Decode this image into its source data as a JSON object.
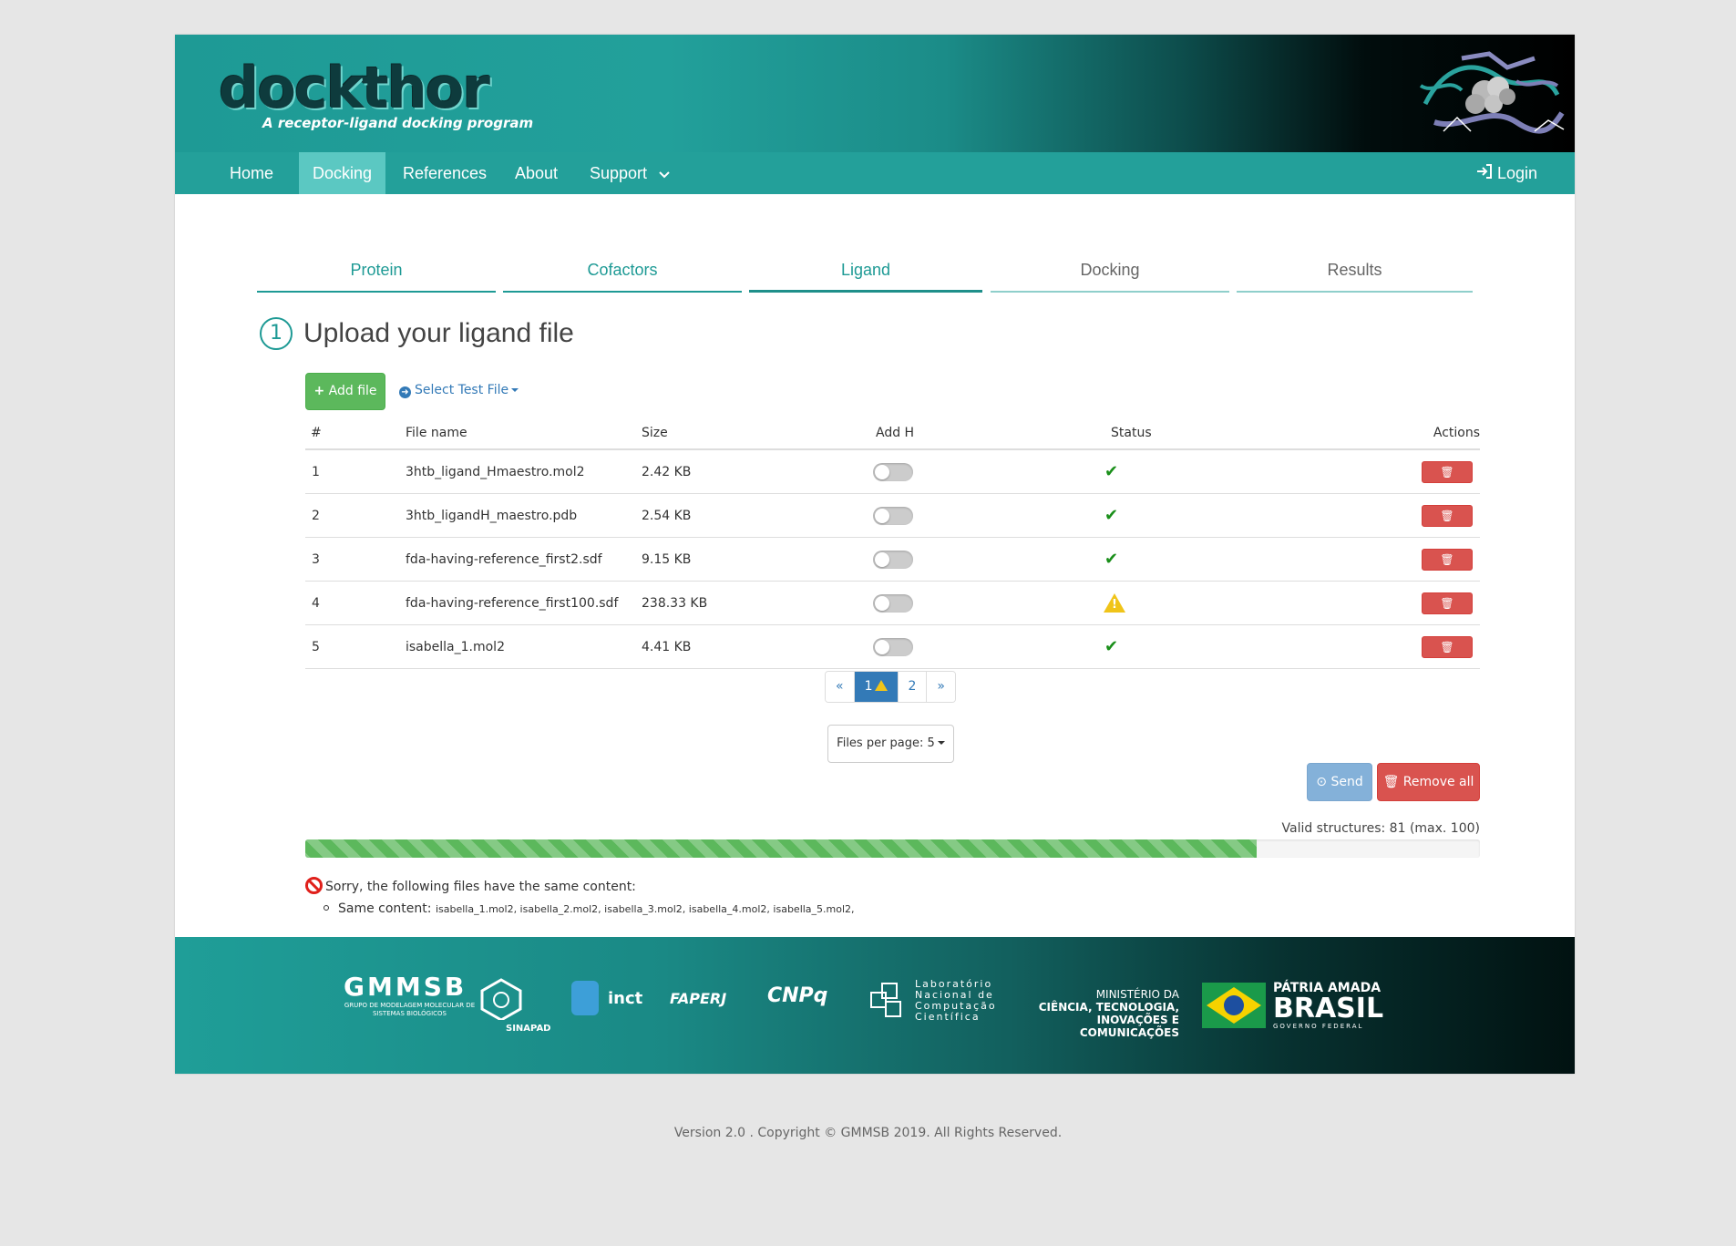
{
  "brand": {
    "logo_text": "dockthor",
    "tagline": "A receptor-ligand docking program"
  },
  "nav": {
    "items": [
      {
        "label": "Home"
      },
      {
        "label": "Docking"
      },
      {
        "label": "References"
      },
      {
        "label": "About"
      },
      {
        "label": "Support"
      }
    ],
    "login_label": "Login"
  },
  "steps": {
    "tabs": [
      {
        "label": "Protein"
      },
      {
        "label": "Cofactors"
      },
      {
        "label": "Ligand"
      },
      {
        "label": "Docking"
      },
      {
        "label": "Results"
      }
    ]
  },
  "upload": {
    "step_number": "1",
    "title": "Upload your ligand file",
    "add_file_label": "Add file",
    "select_test_label": "Select Test File"
  },
  "table": {
    "headers": [
      "#",
      "File name",
      "Size",
      "Add H",
      "Status",
      "Actions"
    ],
    "rows": [
      {
        "num": "1",
        "name": "3htb_ligand_Hmaestro.mol2",
        "size": "2.42 KB",
        "status": "ok"
      },
      {
        "num": "2",
        "name": "3htb_ligandH_maestro.pdb",
        "size": "2.54 KB",
        "status": "ok"
      },
      {
        "num": "3",
        "name": "fda-having-reference_first2.sdf",
        "size": "9.15 KB",
        "status": "ok"
      },
      {
        "num": "4",
        "name": "fda-having-reference_first100.sdf",
        "size": "238.33 KB",
        "status": "warning"
      },
      {
        "num": "5",
        "name": "isabella_1.mol2",
        "size": "4.41 KB",
        "status": "ok"
      }
    ]
  },
  "pagination": {
    "prev": "«",
    "pages": [
      "1",
      "2"
    ],
    "next": "»",
    "current": "1"
  },
  "files_per_page": "Files per page: 5",
  "actions": {
    "send_label": "Send",
    "remove_all_label": "Remove all"
  },
  "validity": {
    "text": "Valid structures: 81 (max. 100)",
    "fraction": 0.81
  },
  "duplicates": {
    "message": "Sorry, the following files have the same content:",
    "item_label": "Same content:",
    "files": "isabella_1.mol2, isabella_2.mol2, isabella_3.mol2, isabella_4.mol2, isabella_5.mol2,"
  },
  "footer_logos": {
    "gmmsb": "GMMSB",
    "gmmsb_sub": "GRUPO DE MODELAGEM MOLECULAR DE SISTEMAS BIOLÓGICOS",
    "sinapad": "SINAPAD",
    "inct": "inct",
    "faperj": "FAPERJ",
    "cnpq": "CNPq",
    "lncc": "Laboratório Nacional de Computação Científica",
    "mctic_1": "MINISTÉRIO DA",
    "mctic_2": "CIÊNCIA, TECNOLOGIA,",
    "mctic_3": "INOVAÇÕES E COMUNICAÇÕES",
    "brasil_1": "PÁTRIA AMADA",
    "brasil_2": "BRASIL",
    "brasil_3": "GOVERNO FEDERAL"
  },
  "copyright": "Version 2.0 . Copyright © GMMSB 2019. All Rights Reserved.",
  "colors": {
    "teal": "#23a09a",
    "active_nav": "#5bc8c2",
    "success": "#5cb85c",
    "danger": "#d9534f",
    "primary": "#337ab7"
  }
}
